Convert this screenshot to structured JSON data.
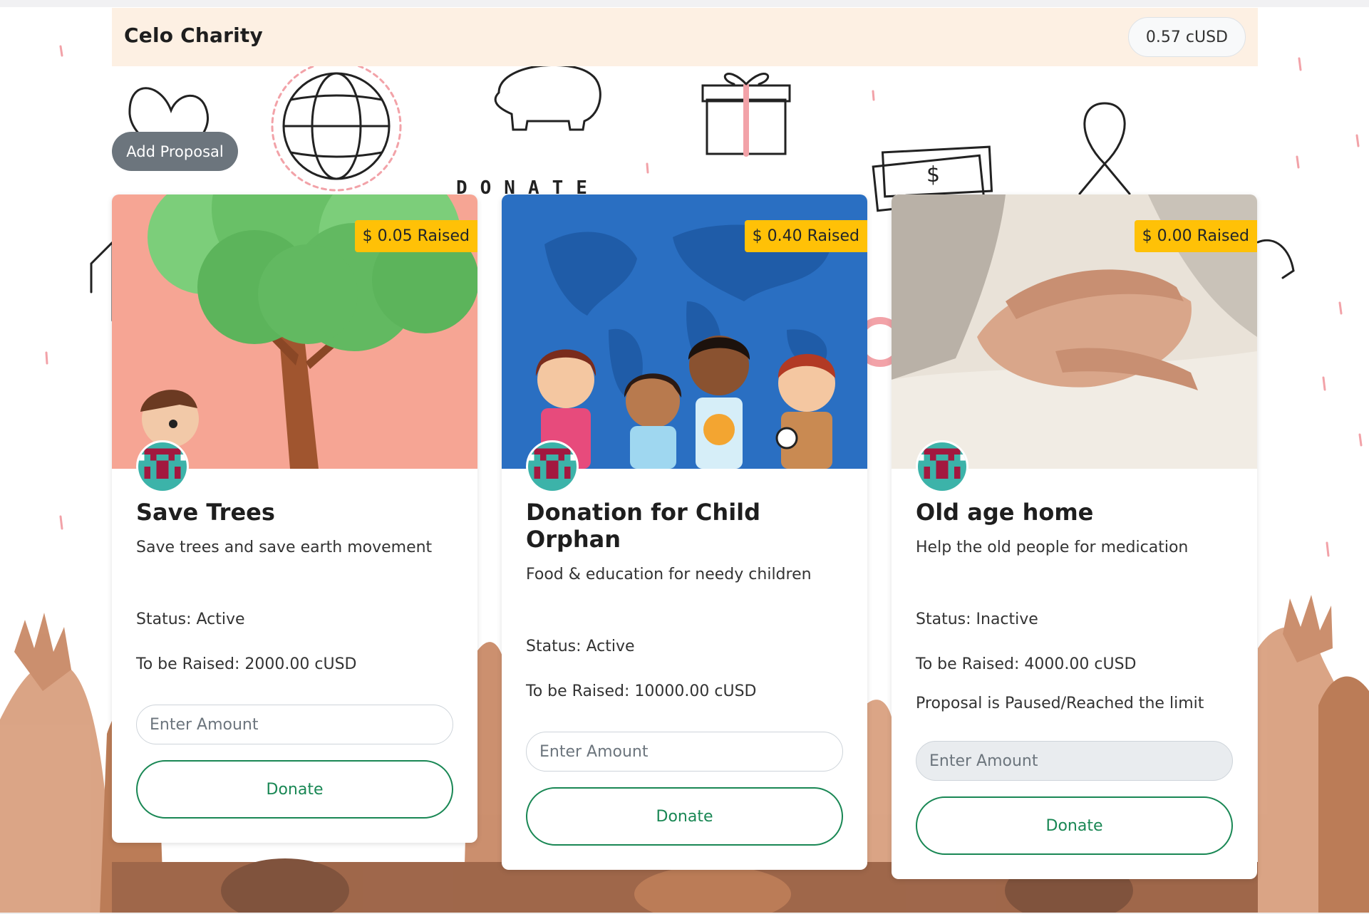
{
  "app": {
    "brand": "Celo Charity",
    "balance": "0.57 cUSD"
  },
  "actions": {
    "add_proposal": "Add Proposal"
  },
  "background": {
    "donate_word": "DONATE"
  },
  "colors": {
    "badge": "#ffc107",
    "donate_border": "#198754",
    "navbar": "#fdf0e3",
    "add_button": "#6c757d"
  },
  "cards": [
    {
      "raised": "$ 0.05 Raised",
      "title": "Save Trees",
      "description": "Save trees and save earth movement",
      "status": "Status: Active",
      "target": "To be Raised: 2000.00 cUSD",
      "notice": "",
      "placeholder": "Enter Amount",
      "donate_label": "Donate"
    },
    {
      "raised": "$ 0.40 Raised",
      "title": "Donation for Child Orphan",
      "description": "Food & education for needy children",
      "status": "Status: Active",
      "target": "To be Raised: 10000.00 cUSD",
      "notice": "",
      "placeholder": "Enter Amount",
      "donate_label": "Donate"
    },
    {
      "raised": "$ 0.00 Raised",
      "title": "Old age home",
      "description": "Help the old people for medication",
      "status": "Status: Inactive",
      "target": "To be Raised: 4000.00 cUSD",
      "notice": "Proposal is Paused/Reached the limit",
      "placeholder": "Enter Amount",
      "donate_label": "Donate"
    }
  ]
}
